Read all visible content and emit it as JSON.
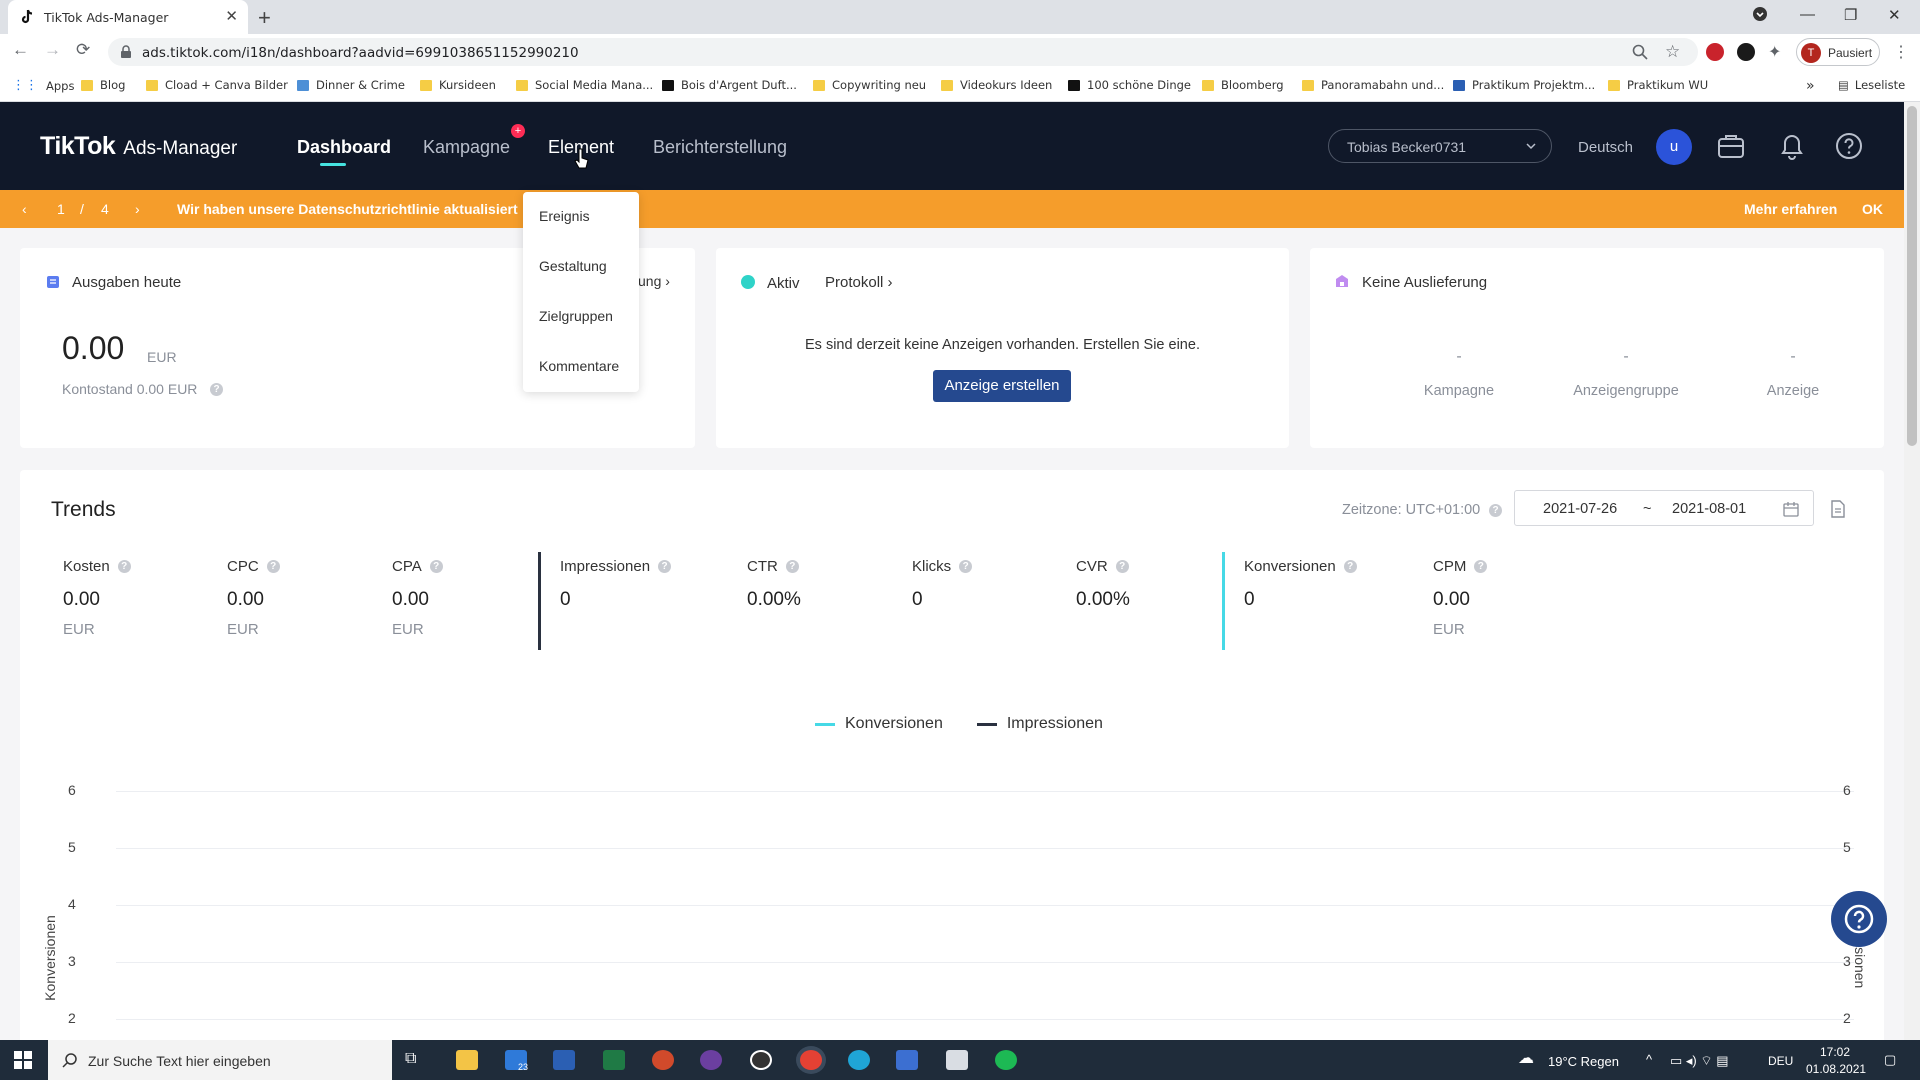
{
  "browser": {
    "tab_title": "TikTok Ads-Manager",
    "url": "ads.tiktok.com/i18n/dashboard?aadvid=6991038651152990210",
    "profile_label": "Pausiert",
    "profile_initial": "T",
    "bookmarks": [
      "Apps",
      "Blog",
      "Cload + Canva Bilder",
      "Dinner & Crime",
      "Kursideen",
      "Social Media Mana...",
      "Bois d'Argent Duft...",
      "Copywriting neu",
      "Videokurs Ideen",
      "100 schöne Dinge",
      "Bloomberg",
      "Panoramabahn und...",
      "Praktikum Projektm...",
      "Praktikum WU"
    ],
    "reading_list": "Leseliste",
    "bookmarks_more": "»"
  },
  "header": {
    "logo_brand": "TikTok",
    "logo_product": "Ads-Manager",
    "nav": [
      "Dashboard",
      "Kampagne",
      "Element",
      "Berichterstellung"
    ],
    "kampagne_badge": "+",
    "account": "Tobias Becker0731",
    "language": "Deutsch",
    "avatar_initial": "u"
  },
  "banner": {
    "page_current": "1",
    "page_sep": "/",
    "page_total": "4",
    "message": "Wir haben unsere Datenschutzrichtlinie aktualisiert",
    "learn_more": "Mehr erfahren",
    "ok": "OK"
  },
  "dropdown": {
    "items": [
      "Ereignis",
      "Gestaltung",
      "Zielgruppen",
      "Kommentare"
    ]
  },
  "spend_card": {
    "title": "Ausgaben heute",
    "amount": "0.00",
    "currency": "EUR",
    "balance": "Kontostand 0.00 EUR",
    "partial_link": "ung"
  },
  "active_card": {
    "status": "Aktiv",
    "log_link": "Protokoll",
    "empty_text": "Es sind derzeit keine Anzeigen vorhanden. Erstellen Sie eine.",
    "create_button": "Anzeige erstellen"
  },
  "delivery_card": {
    "title": "Keine Auslieferung",
    "columns": [
      {
        "value": "-",
        "label": "Kampagne"
      },
      {
        "value": "-",
        "label": "Anzeigengruppe"
      },
      {
        "value": "-",
        "label": "Anzeige"
      }
    ]
  },
  "trends": {
    "title": "Trends",
    "timezone": "Zeitzone: UTC+01:00",
    "date_from": "2021-07-26",
    "date_sep": "~",
    "date_to": "2021-08-01",
    "metrics": [
      {
        "name": "Kosten",
        "value": "0.00",
        "unit": "EUR"
      },
      {
        "name": "CPC",
        "value": "0.00",
        "unit": "EUR"
      },
      {
        "name": "CPA",
        "value": "0.00",
        "unit": "EUR"
      },
      {
        "name": "Impressionen",
        "value": "0",
        "unit": ""
      },
      {
        "name": "CTR",
        "value": "0.00%",
        "unit": ""
      },
      {
        "name": "Klicks",
        "value": "0",
        "unit": ""
      },
      {
        "name": "CVR",
        "value": "0.00%",
        "unit": ""
      },
      {
        "name": "Konversionen",
        "value": "0",
        "unit": ""
      },
      {
        "name": "CPM",
        "value": "0.00",
        "unit": "EUR"
      }
    ]
  },
  "chart_data": {
    "type": "line",
    "legend": [
      "Konversionen",
      "Impressionen"
    ],
    "series": [
      {
        "name": "Konversionen",
        "values": [],
        "color": "#46d9e6"
      },
      {
        "name": "Impressionen",
        "values": [],
        "color": "#2a3140"
      }
    ],
    "ylabel": "Konversionen",
    "ylabel_right": "ressionen",
    "yticks_visible": [
      "6",
      "5",
      "4",
      "3",
      "2"
    ],
    "grid": true
  },
  "taskbar": {
    "search_placeholder": "Zur Suche Text hier eingeben",
    "mail_badge": "23",
    "weather": "19°C  Regen",
    "lang": "DEU",
    "time": "17:02",
    "date": "01.08.2021"
  }
}
